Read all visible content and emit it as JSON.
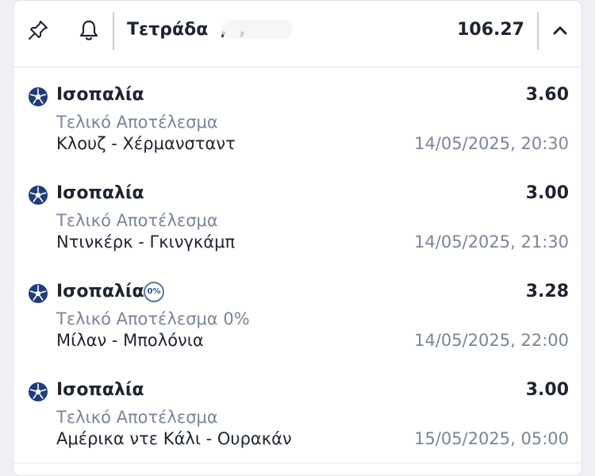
{
  "header": {
    "title": "Τετράδα  ,  ,",
    "odds": "106.27",
    "pin_icon": "pin-icon",
    "bell_icon": "bell-icon",
    "collapse_icon": "chevron-up-icon"
  },
  "selections": [
    {
      "name": "Ισοπαλία",
      "odds": "3.60",
      "market": "Τελικό Αποτέλεσμα",
      "event": "Κλουζ - Χέρμανσταντ",
      "date": "14/05/2025, 20:30",
      "icon": "soccer-ball-icon"
    },
    {
      "name": "Ισοπαλία",
      "odds": "3.00",
      "market": "Τελικό Αποτέλεσμα",
      "event": "Ντινκέρκ - Γκινγκάμπ",
      "date": "14/05/2025, 21:30",
      "icon": "soccer-ball-icon"
    },
    {
      "name": "Ισοπαλία",
      "odds": "3.28",
      "badge": "0%",
      "market": "Τελικό Αποτέλεσμα 0%",
      "event": "Μίλαν - Μπολόνια",
      "date": "14/05/2025, 22:00",
      "icon": "soccer-ball-icon"
    },
    {
      "name": "Ισοπαλία",
      "odds": "3.00",
      "market": "Τελικό Αποτέλεσμα",
      "event": "Αμέρικα ντε Κάλι - Ουρακάν",
      "date": "15/05/2025, 05:00",
      "icon": "soccer-ball-icon"
    }
  ],
  "colors": {
    "text_primary": "#1e2530",
    "text_secondary": "#7a8697",
    "ball_blue": "#1f3d7a"
  }
}
